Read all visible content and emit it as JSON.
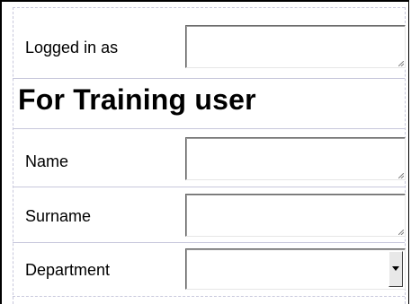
{
  "form": {
    "logged_in": {
      "label": "Logged in as",
      "value": ""
    },
    "heading": "For Training user",
    "fields": [
      {
        "label": "Name",
        "value": ""
      },
      {
        "label": "Surname",
        "value": ""
      }
    ],
    "department": {
      "label": "Department",
      "selected": ""
    }
  },
  "icons": {
    "resize": "resize-grip-icon",
    "dropdown": "chevron-down-icon"
  },
  "colors": {
    "guide_line": "#c8c8dc",
    "control_border": "#646464",
    "button_face": "#e8e8e8"
  }
}
